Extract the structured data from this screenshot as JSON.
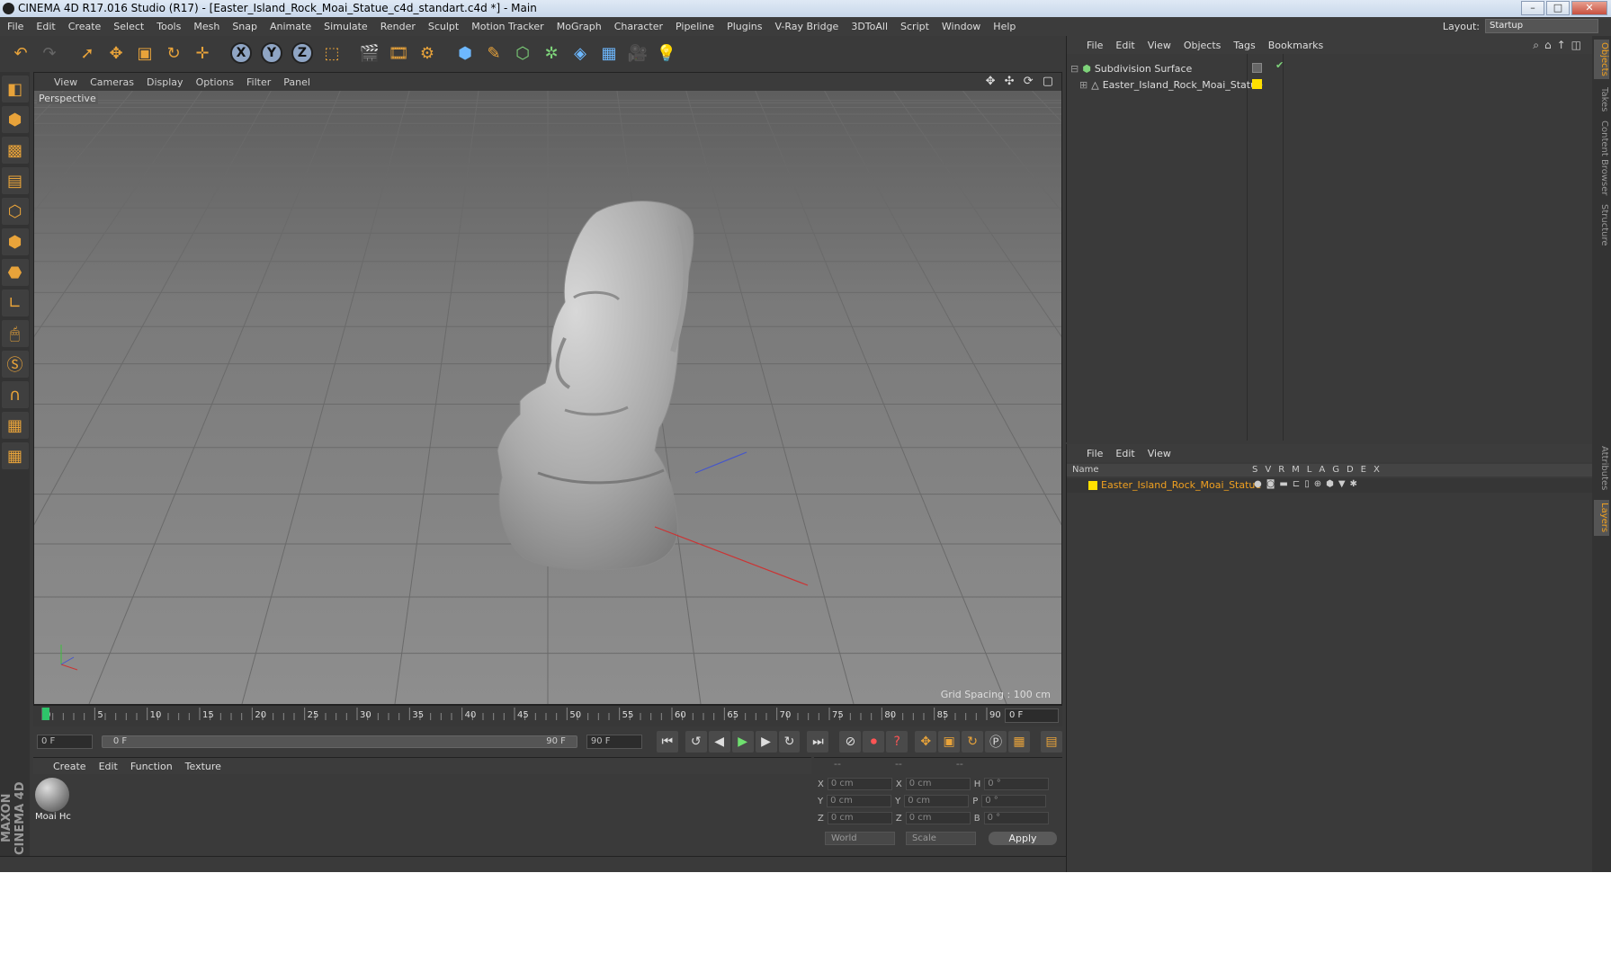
{
  "window": {
    "title": "CINEMA 4D R17.016 Studio (R17) - [Easter_Island_Rock_Moai_Statue_c4d_standart.c4d *] - Main",
    "buttons": [
      "–",
      "□",
      "✕"
    ]
  },
  "menubar": {
    "items": [
      "File",
      "Edit",
      "Create",
      "Select",
      "Tools",
      "Mesh",
      "Snap",
      "Animate",
      "Simulate",
      "Render",
      "Sculpt",
      "Motion Tracker",
      "MoGraph",
      "Character",
      "Pipeline",
      "Plugins",
      "V-Ray Bridge",
      "3DToAll",
      "Script",
      "Window",
      "Help"
    ],
    "layout_label": "Layout:",
    "layout_value": "Startup"
  },
  "viewport": {
    "menu": [
      "View",
      "Cameras",
      "Display",
      "Options",
      "Filter",
      "Panel"
    ],
    "label": "Perspective",
    "grid_spacing": "Grid Spacing : 100 cm",
    "nav_icons": "✥ ✣ ⟳ ▢"
  },
  "timeline": {
    "ticks": [
      "0",
      "5",
      "10",
      "15",
      "20",
      "25",
      "30",
      "35",
      "40",
      "45",
      "50",
      "55",
      "60",
      "65",
      "70",
      "75",
      "80",
      "85",
      "90"
    ],
    "current_frame": "0 F",
    "current_position_fraction": 0.0
  },
  "playback": {
    "start_field": "0 F",
    "range_start": "0 F",
    "range_end": "90 F",
    "end_field": "90 F"
  },
  "material_panel": {
    "menu": [
      "Create",
      "Edit",
      "Function",
      "Texture"
    ],
    "materials": [
      {
        "label": "Moai Hc"
      }
    ]
  },
  "coordinates": {
    "headers": [
      "--",
      "--",
      "--"
    ],
    "rows": [
      {
        "a": "X",
        "a_val": "0 cm",
        "b": "X",
        "b_val": "0 cm",
        "c": "H",
        "c_val": "0 °"
      },
      {
        "a": "Y",
        "a_val": "0 cm",
        "b": "Y",
        "b_val": "0 cm",
        "c": "P",
        "c_val": "0 °"
      },
      {
        "a": "Z",
        "a_val": "0 cm",
        "b": "Z",
        "b_val": "0 cm",
        "c": "B",
        "c_val": "0 °"
      }
    ],
    "mode": "World",
    "transform": "Scale",
    "apply": "Apply"
  },
  "object_manager": {
    "menu": [
      "File",
      "Edit",
      "View",
      "Objects",
      "Tags",
      "Bookmarks"
    ],
    "objects": [
      {
        "name": "Subdivision Surface",
        "icon": "subdivision-icon",
        "color": "#7ed37a"
      },
      {
        "name": "Easter_Island_Rock_Moai_Statue",
        "icon": "polygon-object-icon",
        "color": "#ffe000"
      }
    ]
  },
  "layer_manager": {
    "menu": [
      "File",
      "Edit",
      "View"
    ],
    "col_name": "Name",
    "flags": [
      "S",
      "V",
      "R",
      "M",
      "L",
      "A",
      "G",
      "D",
      "E",
      "X"
    ],
    "layers": [
      {
        "name": "Easter_Island_Rock_Moai_Statue",
        "color": "#ffe000"
      }
    ]
  },
  "side_tabs": [
    "Objects",
    "Takes",
    "Content Browser",
    "Structure",
    "Attributes",
    "Layers"
  ],
  "brand": "MAXON CINEMA 4D",
  "colors": {
    "accent": "#e8a33a",
    "layer_name": "#f0a020",
    "layer_color": "#ffe000"
  }
}
